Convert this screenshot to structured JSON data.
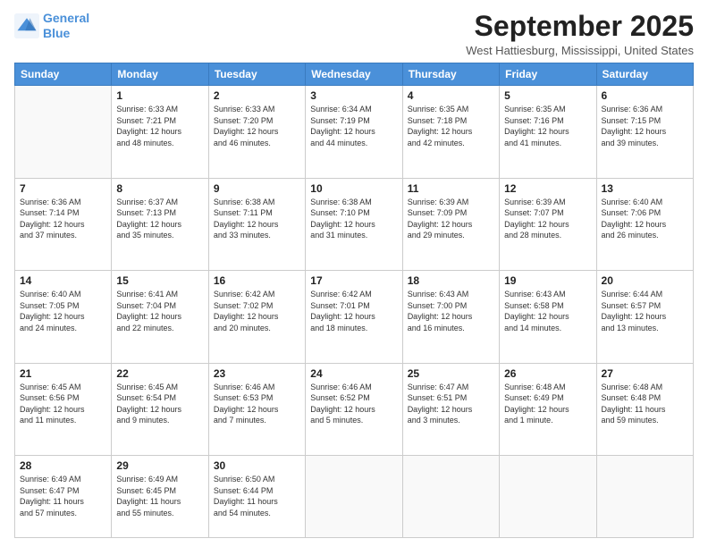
{
  "header": {
    "logo_line1": "General",
    "logo_line2": "Blue",
    "month_title": "September 2025",
    "location": "West Hattiesburg, Mississippi, United States"
  },
  "weekdays": [
    "Sunday",
    "Monday",
    "Tuesday",
    "Wednesday",
    "Thursday",
    "Friday",
    "Saturday"
  ],
  "weeks": [
    [
      {
        "day": "",
        "info": ""
      },
      {
        "day": "1",
        "info": "Sunrise: 6:33 AM\nSunset: 7:21 PM\nDaylight: 12 hours\nand 48 minutes."
      },
      {
        "day": "2",
        "info": "Sunrise: 6:33 AM\nSunset: 7:20 PM\nDaylight: 12 hours\nand 46 minutes."
      },
      {
        "day": "3",
        "info": "Sunrise: 6:34 AM\nSunset: 7:19 PM\nDaylight: 12 hours\nand 44 minutes."
      },
      {
        "day": "4",
        "info": "Sunrise: 6:35 AM\nSunset: 7:18 PM\nDaylight: 12 hours\nand 42 minutes."
      },
      {
        "day": "5",
        "info": "Sunrise: 6:35 AM\nSunset: 7:16 PM\nDaylight: 12 hours\nand 41 minutes."
      },
      {
        "day": "6",
        "info": "Sunrise: 6:36 AM\nSunset: 7:15 PM\nDaylight: 12 hours\nand 39 minutes."
      }
    ],
    [
      {
        "day": "7",
        "info": "Sunrise: 6:36 AM\nSunset: 7:14 PM\nDaylight: 12 hours\nand 37 minutes."
      },
      {
        "day": "8",
        "info": "Sunrise: 6:37 AM\nSunset: 7:13 PM\nDaylight: 12 hours\nand 35 minutes."
      },
      {
        "day": "9",
        "info": "Sunrise: 6:38 AM\nSunset: 7:11 PM\nDaylight: 12 hours\nand 33 minutes."
      },
      {
        "day": "10",
        "info": "Sunrise: 6:38 AM\nSunset: 7:10 PM\nDaylight: 12 hours\nand 31 minutes."
      },
      {
        "day": "11",
        "info": "Sunrise: 6:39 AM\nSunset: 7:09 PM\nDaylight: 12 hours\nand 29 minutes."
      },
      {
        "day": "12",
        "info": "Sunrise: 6:39 AM\nSunset: 7:07 PM\nDaylight: 12 hours\nand 28 minutes."
      },
      {
        "day": "13",
        "info": "Sunrise: 6:40 AM\nSunset: 7:06 PM\nDaylight: 12 hours\nand 26 minutes."
      }
    ],
    [
      {
        "day": "14",
        "info": "Sunrise: 6:40 AM\nSunset: 7:05 PM\nDaylight: 12 hours\nand 24 minutes."
      },
      {
        "day": "15",
        "info": "Sunrise: 6:41 AM\nSunset: 7:04 PM\nDaylight: 12 hours\nand 22 minutes."
      },
      {
        "day": "16",
        "info": "Sunrise: 6:42 AM\nSunset: 7:02 PM\nDaylight: 12 hours\nand 20 minutes."
      },
      {
        "day": "17",
        "info": "Sunrise: 6:42 AM\nSunset: 7:01 PM\nDaylight: 12 hours\nand 18 minutes."
      },
      {
        "day": "18",
        "info": "Sunrise: 6:43 AM\nSunset: 7:00 PM\nDaylight: 12 hours\nand 16 minutes."
      },
      {
        "day": "19",
        "info": "Sunrise: 6:43 AM\nSunset: 6:58 PM\nDaylight: 12 hours\nand 14 minutes."
      },
      {
        "day": "20",
        "info": "Sunrise: 6:44 AM\nSunset: 6:57 PM\nDaylight: 12 hours\nand 13 minutes."
      }
    ],
    [
      {
        "day": "21",
        "info": "Sunrise: 6:45 AM\nSunset: 6:56 PM\nDaylight: 12 hours\nand 11 minutes."
      },
      {
        "day": "22",
        "info": "Sunrise: 6:45 AM\nSunset: 6:54 PM\nDaylight: 12 hours\nand 9 minutes."
      },
      {
        "day": "23",
        "info": "Sunrise: 6:46 AM\nSunset: 6:53 PM\nDaylight: 12 hours\nand 7 minutes."
      },
      {
        "day": "24",
        "info": "Sunrise: 6:46 AM\nSunset: 6:52 PM\nDaylight: 12 hours\nand 5 minutes."
      },
      {
        "day": "25",
        "info": "Sunrise: 6:47 AM\nSunset: 6:51 PM\nDaylight: 12 hours\nand 3 minutes."
      },
      {
        "day": "26",
        "info": "Sunrise: 6:48 AM\nSunset: 6:49 PM\nDaylight: 12 hours\nand 1 minute."
      },
      {
        "day": "27",
        "info": "Sunrise: 6:48 AM\nSunset: 6:48 PM\nDaylight: 11 hours\nand 59 minutes."
      }
    ],
    [
      {
        "day": "28",
        "info": "Sunrise: 6:49 AM\nSunset: 6:47 PM\nDaylight: 11 hours\nand 57 minutes."
      },
      {
        "day": "29",
        "info": "Sunrise: 6:49 AM\nSunset: 6:45 PM\nDaylight: 11 hours\nand 55 minutes."
      },
      {
        "day": "30",
        "info": "Sunrise: 6:50 AM\nSunset: 6:44 PM\nDaylight: 11 hours\nand 54 minutes."
      },
      {
        "day": "",
        "info": ""
      },
      {
        "day": "",
        "info": ""
      },
      {
        "day": "",
        "info": ""
      },
      {
        "day": "",
        "info": ""
      }
    ]
  ]
}
